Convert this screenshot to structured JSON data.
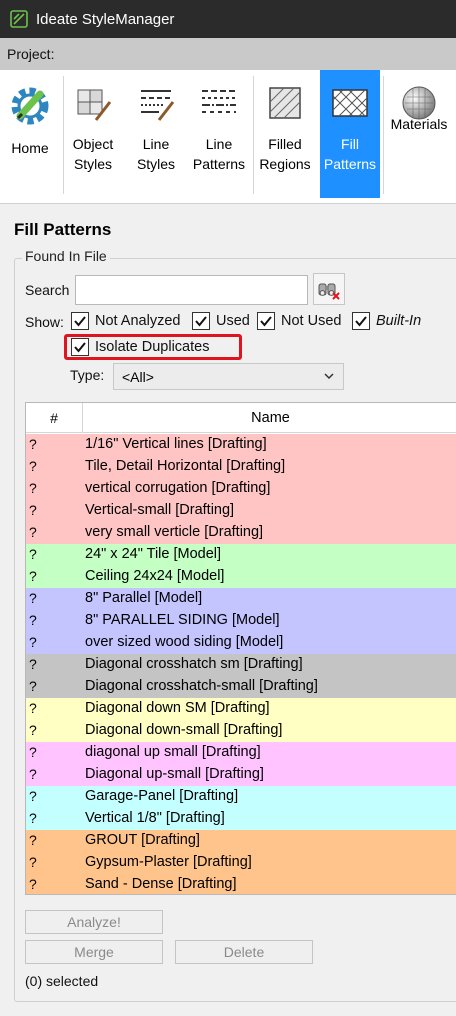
{
  "window": {
    "title": "Ideate StyleManager"
  },
  "project_label": "Project:",
  "ribbon": {
    "buttons": [
      {
        "id": "home",
        "label": "Home"
      },
      {
        "id": "object-styles",
        "label": "Object Styles"
      },
      {
        "id": "line-styles",
        "label": "Line Styles"
      },
      {
        "id": "line-patterns",
        "label": "Line Patterns"
      },
      {
        "id": "filled-regions",
        "label": "Filled Regions"
      },
      {
        "id": "fill-patterns",
        "label": "Fill Patterns",
        "active": true
      },
      {
        "id": "materials",
        "label": "Materials"
      }
    ]
  },
  "heading": "Fill Patterns",
  "group_title": "Found In File",
  "search": {
    "label": "Search",
    "value": "",
    "placeholder": ""
  },
  "show": {
    "label": "Show:",
    "options": [
      {
        "label": "Not Analyzed",
        "checked": true
      },
      {
        "label": "Used",
        "checked": true
      },
      {
        "label": "Not Used",
        "checked": true
      },
      {
        "label": "Built-In",
        "checked": true
      }
    ],
    "isolate_duplicates": {
      "label": "Isolate Duplicates",
      "checked": true
    }
  },
  "type": {
    "label": "Type:",
    "value": "<All>"
  },
  "grid": {
    "columns": [
      "#",
      "Name"
    ],
    "rows": [
      {
        "status": "?",
        "name": "1/16\" Vertical lines [Drafting]",
        "color": "#ffc4c4"
      },
      {
        "status": "?",
        "name": "Tile, Detail Horizontal [Drafting]",
        "color": "#ffc4c4"
      },
      {
        "status": "?",
        "name": "vertical corrugation [Drafting]",
        "color": "#ffc4c4"
      },
      {
        "status": "?",
        "name": "Vertical-small [Drafting]",
        "color": "#ffc4c4"
      },
      {
        "status": "?",
        "name": "very small verticle [Drafting]",
        "color": "#ffc4c4"
      },
      {
        "status": "?",
        "name": "24\" x 24\" Tile [Model]",
        "color": "#c4ffc4"
      },
      {
        "status": "?",
        "name": "Ceiling 24x24 [Model]",
        "color": "#c4ffc4"
      },
      {
        "status": "?",
        "name": "8\" Parallel [Model]",
        "color": "#c4c4ff"
      },
      {
        "status": "?",
        "name": "8\" PARALLEL SIDING [Model]",
        "color": "#c4c4ff"
      },
      {
        "status": "?",
        "name": "over sized wood siding [Model]",
        "color": "#c4c4ff"
      },
      {
        "status": "?",
        "name": "Diagonal crosshatch sm [Drafting]",
        "color": "#c4c4c4"
      },
      {
        "status": "?",
        "name": "Diagonal crosshatch-small [Drafting]",
        "color": "#c4c4c4"
      },
      {
        "status": "?",
        "name": "Diagonal down SM [Drafting]",
        "color": "#ffffc4"
      },
      {
        "status": "?",
        "name": "Diagonal down-small [Drafting]",
        "color": "#ffffc4"
      },
      {
        "status": "?",
        "name": "diagonal up small [Drafting]",
        "color": "#ffc4ff"
      },
      {
        "status": "?",
        "name": "Diagonal up-small [Drafting]",
        "color": "#ffc4ff"
      },
      {
        "status": "?",
        "name": "Garage-Panel [Drafting]",
        "color": "#c4ffff"
      },
      {
        "status": "?",
        "name": "Vertical 1/8\" [Drafting]",
        "color": "#c4ffff"
      },
      {
        "status": "?",
        "name": "GROUT [Drafting]",
        "color": "#ffc48c"
      },
      {
        "status": "?",
        "name": "Gypsum-Plaster [Drafting]",
        "color": "#ffc48c"
      },
      {
        "status": "?",
        "name": "Sand - Dense [Drafting]",
        "color": "#ffc48c"
      }
    ]
  },
  "buttons": {
    "analyze": "Analyze!",
    "merge": "Merge",
    "delete": "Delete"
  },
  "status": "(0) selected"
}
